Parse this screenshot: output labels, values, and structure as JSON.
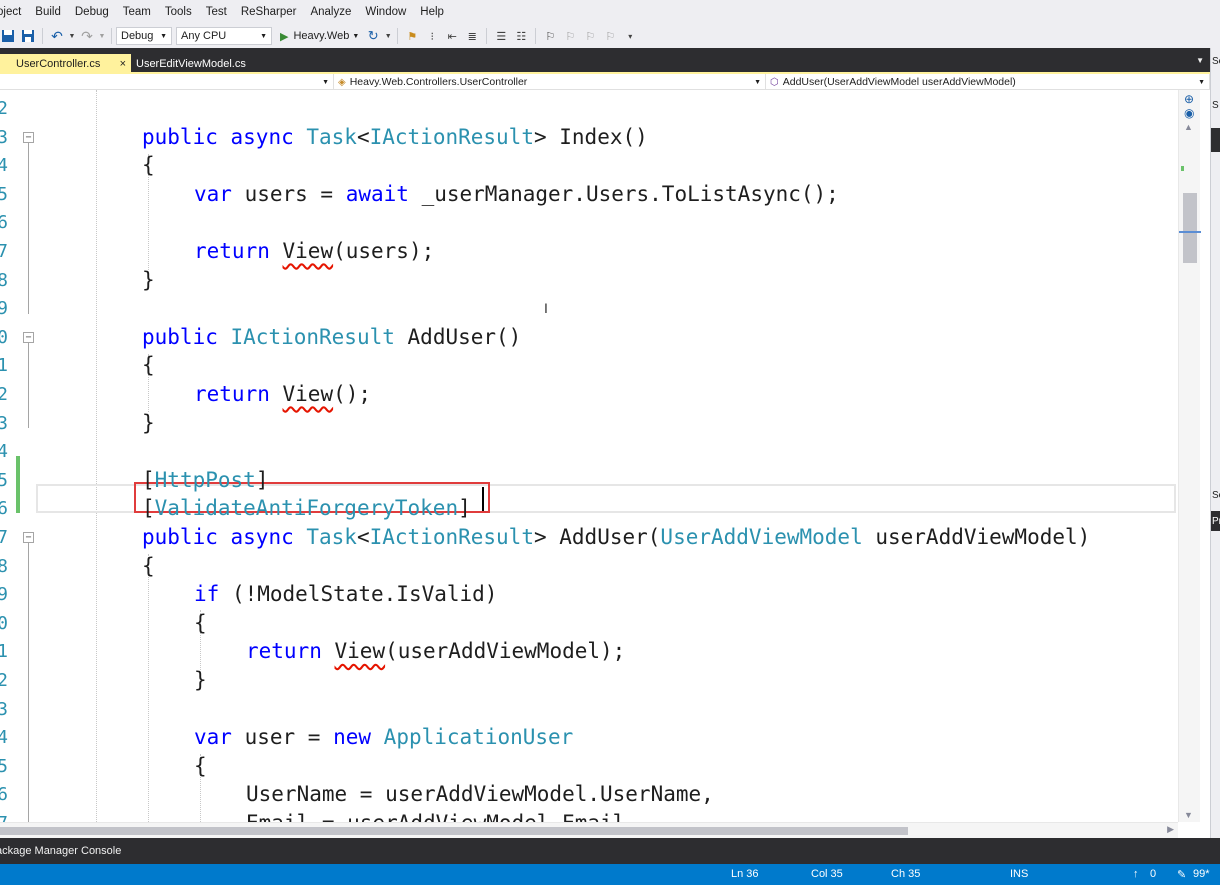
{
  "menu": [
    "oject",
    "Build",
    "Debug",
    "Team",
    "Tools",
    "Test",
    "ReSharper",
    "Analyze",
    "Window",
    "Help"
  ],
  "toolbar": {
    "config": "Debug",
    "platform": "Any CPU",
    "run_target": "Heavy.Web"
  },
  "tabs": {
    "active": "UserController.cs",
    "inactive": "UserEditViewModel.cs",
    "close_glyph": "×"
  },
  "navbar": {
    "class_path": "Heavy.Web.Controllers.UserController",
    "member": "AddUser(UserAddViewModel userAddViewModel)"
  },
  "right_strip": {
    "label_se": "Se",
    "label_s": "S",
    "label_se2": "Se",
    "label_pr": "Pr"
  },
  "code_lines": [
    {
      "n": "2",
      "tokens": []
    },
    {
      "n": "3",
      "tokens": [
        [
          "k",
          "public "
        ],
        [
          "k",
          "async "
        ],
        [
          "t",
          "Task"
        ],
        [
          "p",
          "<"
        ],
        [
          "t",
          "IActionResult"
        ],
        [
          "p",
          "> Index()"
        ]
      ]
    },
    {
      "n": "4",
      "tokens": [
        [
          "p",
          "{"
        ]
      ]
    },
    {
      "n": "5",
      "tokens": [
        [
          "k",
          "var "
        ],
        [
          "p",
          "users = "
        ],
        [
          "k",
          "await "
        ],
        [
          "p",
          "_userManager.Users.ToListAsync();"
        ]
      ]
    },
    {
      "n": "6",
      "tokens": []
    },
    {
      "n": "7",
      "tokens": [
        [
          "k",
          "return "
        ],
        [
          "sq",
          "View"
        ],
        [
          "p",
          "(users);"
        ]
      ]
    },
    {
      "n": "8",
      "tokens": [
        [
          "p",
          "}"
        ]
      ]
    },
    {
      "n": "9",
      "tokens": []
    },
    {
      "n": "0",
      "tokens": [
        [
          "k",
          "public "
        ],
        [
          "t",
          "IActionResult "
        ],
        [
          "p",
          "AddUser()"
        ]
      ]
    },
    {
      "n": "1",
      "tokens": [
        [
          "p",
          "{"
        ]
      ]
    },
    {
      "n": "2",
      "tokens": [
        [
          "k",
          "return "
        ],
        [
          "sq",
          "View"
        ],
        [
          "p",
          "();"
        ]
      ]
    },
    {
      "n": "3",
      "tokens": [
        [
          "p",
          "}"
        ]
      ]
    },
    {
      "n": "4",
      "tokens": []
    },
    {
      "n": "5",
      "tokens": [
        [
          "p",
          "["
        ],
        [
          "t",
          "HttpPost"
        ],
        [
          "p",
          "]"
        ]
      ]
    },
    {
      "n": "6",
      "tokens": [
        [
          "p",
          "["
        ],
        [
          "t",
          "ValidateAntiForgeryToken"
        ],
        [
          "p",
          "]"
        ]
      ]
    },
    {
      "n": "7",
      "tokens": [
        [
          "k",
          "public "
        ],
        [
          "k",
          "async "
        ],
        [
          "t",
          "Task"
        ],
        [
          "p",
          "<"
        ],
        [
          "t",
          "IActionResult"
        ],
        [
          "p",
          "> AddUser("
        ],
        [
          "t",
          "UserAddViewModel "
        ],
        [
          "p",
          "userAddViewModel)"
        ]
      ]
    },
    {
      "n": "8",
      "tokens": [
        [
          "p",
          "{"
        ]
      ]
    },
    {
      "n": "9",
      "tokens": [
        [
          "k",
          "if "
        ],
        [
          "p",
          "(!ModelState.IsValid)"
        ]
      ]
    },
    {
      "n": "0",
      "tokens": [
        [
          "p",
          "{"
        ]
      ]
    },
    {
      "n": "1",
      "tokens": [
        [
          "k",
          "return "
        ],
        [
          "sq",
          "View"
        ],
        [
          "p",
          "(userAddViewModel);"
        ]
      ]
    },
    {
      "n": "2",
      "tokens": [
        [
          "p",
          "}"
        ]
      ]
    },
    {
      "n": "3",
      "tokens": []
    },
    {
      "n": "4",
      "tokens": [
        [
          "k",
          "var "
        ],
        [
          "p",
          "user = "
        ],
        [
          "k",
          "new "
        ],
        [
          "t",
          "ApplicationUser"
        ]
      ]
    },
    {
      "n": "5",
      "tokens": [
        [
          "p",
          "{"
        ]
      ]
    },
    {
      "n": "6",
      "tokens": [
        [
          "p",
          "UserName = userAddViewModel.UserName,"
        ]
      ]
    },
    {
      "n": "7",
      "tokens": [
        [
          "p",
          "Email = userAddViewModel.Email,"
        ]
      ]
    }
  ],
  "bottom_panel": {
    "tab": "ackage Manager Console"
  },
  "status": {
    "ln": "Ln 36",
    "col": "Col 35",
    "ch": "Ch 35",
    "mode": "INS",
    "up_count": "0",
    "zoom": "99*",
    "up_glyph": "↑",
    "pencil_glyph": "✎"
  },
  "colors": {
    "keyword": "#0000ff",
    "type": "#2b91af",
    "active_tab": "#fff29d",
    "status_bar": "#007acc",
    "highlight_box": "#e03c3c"
  }
}
